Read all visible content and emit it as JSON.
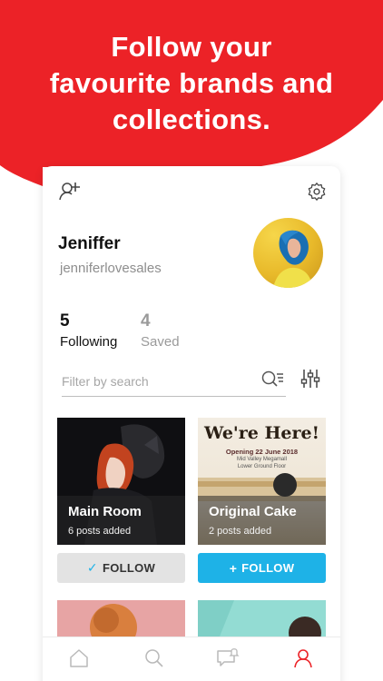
{
  "headline": {
    "line1": "Follow your",
    "line2": "favourite brands and",
    "line3": "collections."
  },
  "colors": {
    "brand_red": "#ec2227",
    "follow_blue": "#1eb2e7",
    "following_bg": "#e3e3e3"
  },
  "profile": {
    "name": "Jeniffer",
    "handle": "jenniferlovesales",
    "avatar_icon": "avatar-photo"
  },
  "stats": [
    {
      "count": "5",
      "label": "Following"
    },
    {
      "count": "4",
      "label": "Saved"
    }
  ],
  "search": {
    "placeholder": "Filter by search",
    "value": ""
  },
  "collections": [
    {
      "title": "Main Room",
      "subtitle": "6 posts added",
      "button": "FOLLOW",
      "state": "following",
      "glyph": "✓"
    },
    {
      "title": "Original Cake",
      "subtitle": "2 posts added",
      "button": "FOLLOW",
      "state": "not-following",
      "glyph": "+",
      "poster": {
        "heading": "We're Here!",
        "line1": "Opening 22 June 2018",
        "line2": "Mid Valley Megamall",
        "line3": "Lower Ground Floor"
      }
    }
  ],
  "tabs": [
    {
      "name": "home",
      "icon": "home-icon"
    },
    {
      "name": "search",
      "icon": "search-icon"
    },
    {
      "name": "notifications",
      "icon": "chat-bell-icon"
    },
    {
      "name": "profile",
      "icon": "profile-icon",
      "active": true
    }
  ]
}
